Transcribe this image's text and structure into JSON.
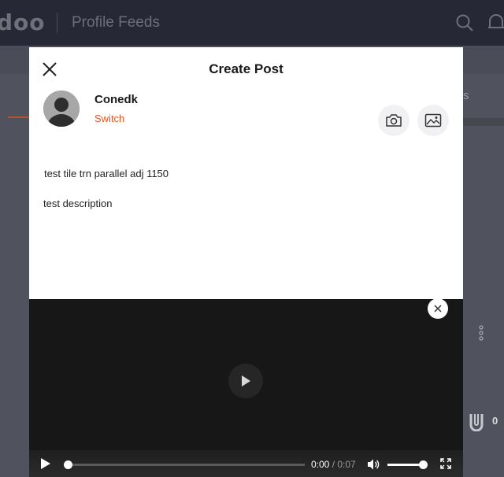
{
  "app": {
    "logo": "doo",
    "title": "Profile Feeds"
  },
  "background": {
    "right_label": "s",
    "count": "0"
  },
  "modal": {
    "title": "Create Post",
    "user": {
      "name": "Conedk",
      "switch_label": "Switch"
    },
    "post": {
      "title": "test tile trn parallel adj 1150",
      "description": "test description"
    }
  },
  "video": {
    "current_time": "0:00",
    "separator": " / ",
    "total_time": "0:07",
    "progress": 0.0,
    "volume": 0.9
  },
  "icons": {
    "close": "close-icon",
    "camera": "camera-icon",
    "image": "image-icon",
    "play": "play-icon",
    "volume": "volume-icon",
    "fullscreen": "fullscreen-icon",
    "search": "search-icon",
    "bell": "bell-icon"
  },
  "colors": {
    "accent": "#e8541e",
    "topbar": "#262836",
    "overlay": "#4a4d58"
  }
}
